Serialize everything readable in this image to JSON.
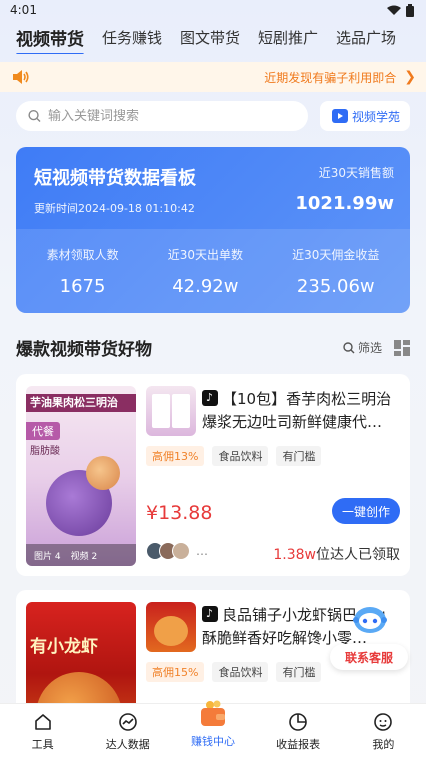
{
  "status": {
    "time": "4:01"
  },
  "tabs": [
    {
      "label": "视频带货",
      "active": true
    },
    {
      "label": "任务赚钱"
    },
    {
      "label": "图文带货"
    },
    {
      "label": "短剧推广"
    },
    {
      "label": "选品广场"
    }
  ],
  "notice": {
    "text": "近期发现有骗子利用即合"
  },
  "search": {
    "placeholder": "输入关键词搜索",
    "academy_label": "视频学苑"
  },
  "dashboard": {
    "title": "短视频带货数据看板",
    "update_time": "更新时间2024-09-18 01:10:42",
    "sales_label": "近30天销售额",
    "sales_value": "1021.99w",
    "metrics": [
      {
        "label": "素材领取人数",
        "value": "1675"
      },
      {
        "label": "近30天出单数",
        "value": "42.92w"
      },
      {
        "label": "近30天佣金收益",
        "value": "235.06w"
      }
    ]
  },
  "section": {
    "title": "爆款视频带货好物",
    "filter_label": "筛选"
  },
  "products": [
    {
      "cover_strip": "芋油果肉松三明治",
      "cover_text1": "代餐",
      "cover_text2": "脂肪酸",
      "cover_meta_images": "图片 4",
      "cover_meta_videos": "视频 2",
      "title": "【10包】香芋肉松三明治爆浆无边吐司新鲜健康代…",
      "tags": [
        "高佣13%",
        "食品饮料",
        "有门槛"
      ],
      "price": "¥13.88",
      "action": "一键创作",
      "claim_count": "1.38w",
      "claim_suffix": "位达人已领取"
    },
    {
      "cover_strip": "有小龙虾",
      "title": "良品铺子小龙虾锅巴40g酥脆鲜香好吃解馋小零…",
      "tags": [
        "高佣15%",
        "食品饮料",
        "有门槛"
      ]
    }
  ],
  "customer_service": {
    "label": "联系客服"
  },
  "navbar": [
    {
      "label": "工具",
      "icon": "home-icon"
    },
    {
      "label": "达人数据",
      "icon": "chart-icon"
    },
    {
      "label": "赚钱中心",
      "icon": "wallet-icon",
      "active": true
    },
    {
      "label": "收益报表",
      "icon": "pie-icon"
    },
    {
      "label": "我的",
      "icon": "profile-icon"
    }
  ],
  "colors": {
    "accent": "#2f6cf5",
    "price": "#e73a3a",
    "notice": "#f07a1d"
  }
}
